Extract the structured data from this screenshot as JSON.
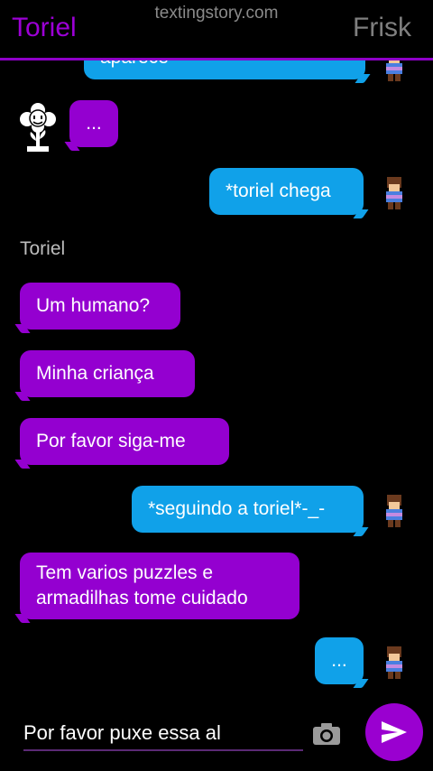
{
  "header": {
    "left_name": "Toriel",
    "right_name": "Frisk",
    "watermark": "textingstory.com"
  },
  "messages": [
    {
      "side": "right",
      "text": "aparece*"
    },
    {
      "side": "left",
      "text": "..."
    },
    {
      "side": "right",
      "text": "*toriel chega"
    },
    {
      "side": "left",
      "text": "Um humano?"
    },
    {
      "side": "left",
      "text": "Minha criança"
    },
    {
      "side": "left",
      "text": "Por favor siga-me"
    },
    {
      "side": "right",
      "text": "*seguindo a toriel*-_-"
    },
    {
      "side": "left",
      "text": "Tem varios puzzles e armadilhas tome cuidado"
    },
    {
      "side": "right",
      "text": "..."
    }
  ],
  "sender_label": "Toriel",
  "composer": {
    "value": "Por favor puxe essa al"
  },
  "colors": {
    "blue_bubble": "#10a1e9",
    "purple_bubble": "#9400d0",
    "accent": "#9c00d6"
  },
  "icons": [
    "flower-avatar-icon",
    "frisk-avatar-icon",
    "camera-icon",
    "send-icon"
  ]
}
